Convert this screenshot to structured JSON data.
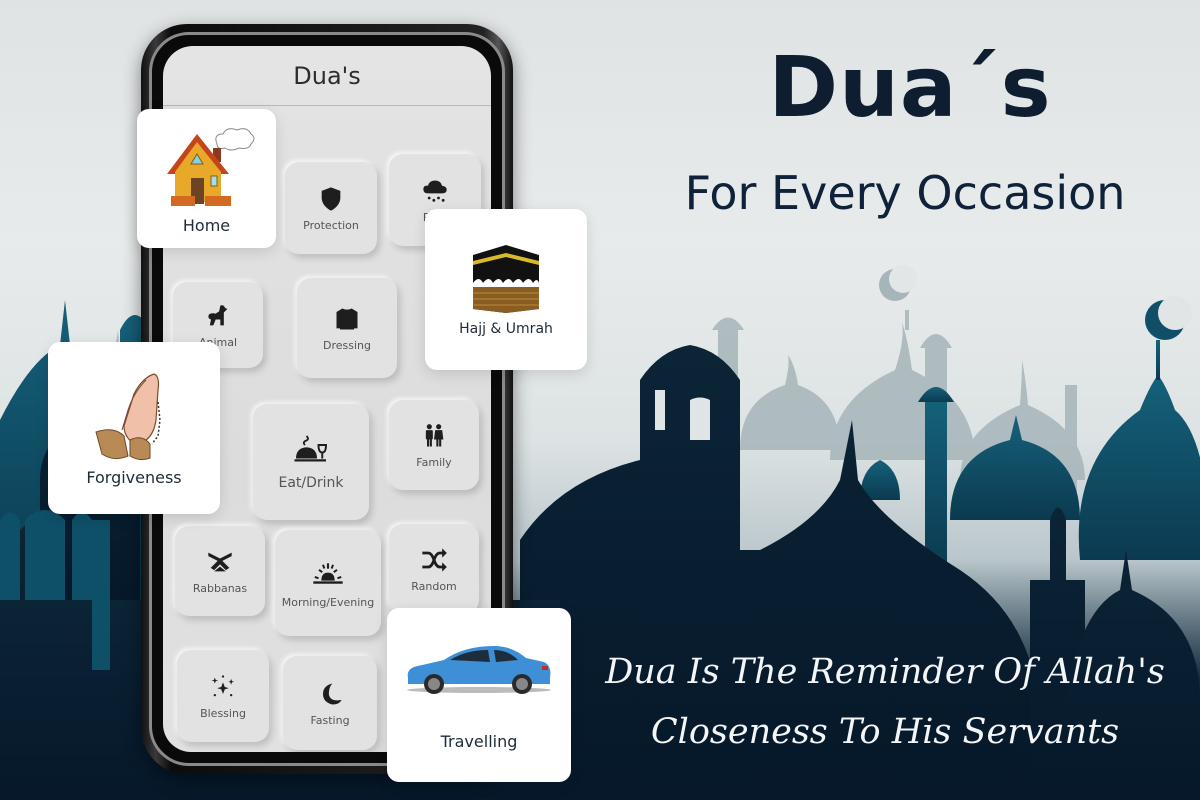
{
  "colors": {
    "headline": "#0e1e30",
    "quote": "#f3f5f7",
    "mosque_dark": "#061a2c",
    "mosque_teal": "#0e5068",
    "mosque_light": "#a9b8bc",
    "phone_frame": "#111111",
    "screen_bg": "#e2e2e2",
    "card_bg": "#ffffff"
  },
  "promo": {
    "title": "Dua´s",
    "subtitle": "For Every Occasion",
    "quote_line1": "Dua Is The Reminder Of Allah's",
    "quote_line2": "Closeness To His Servants"
  },
  "app": {
    "title": "Dua's",
    "tiles": [
      {
        "label": "Protection",
        "icon": "shield-icon"
      },
      {
        "label": "Rain",
        "icon": "rain-cloud-icon"
      },
      {
        "label": "Animal",
        "icon": "dog-icon"
      },
      {
        "label": "Dressing",
        "icon": "shirt-icon"
      },
      {
        "label": "Eat/Drink",
        "icon": "food-cloche-icon"
      },
      {
        "label": "Family",
        "icon": "family-icon"
      },
      {
        "label": "Rabbanas",
        "icon": "quran-book-icon"
      },
      {
        "label": "Morning/Evening",
        "icon": "sunrise-icon"
      },
      {
        "label": "Random",
        "icon": "shuffle-icon"
      },
      {
        "label": "Blessing",
        "icon": "sparkles-icon"
      },
      {
        "label": "Fasting",
        "icon": "crescent-moon-icon"
      }
    ]
  },
  "cards": [
    {
      "label": "Home",
      "icon": "house-icon"
    },
    {
      "label": "Hajj & Umrah",
      "icon": "kaaba-icon"
    },
    {
      "label": "Forgiveness",
      "icon": "praying-hands-icon"
    },
    {
      "label": "Travelling",
      "icon": "car-icon"
    }
  ]
}
